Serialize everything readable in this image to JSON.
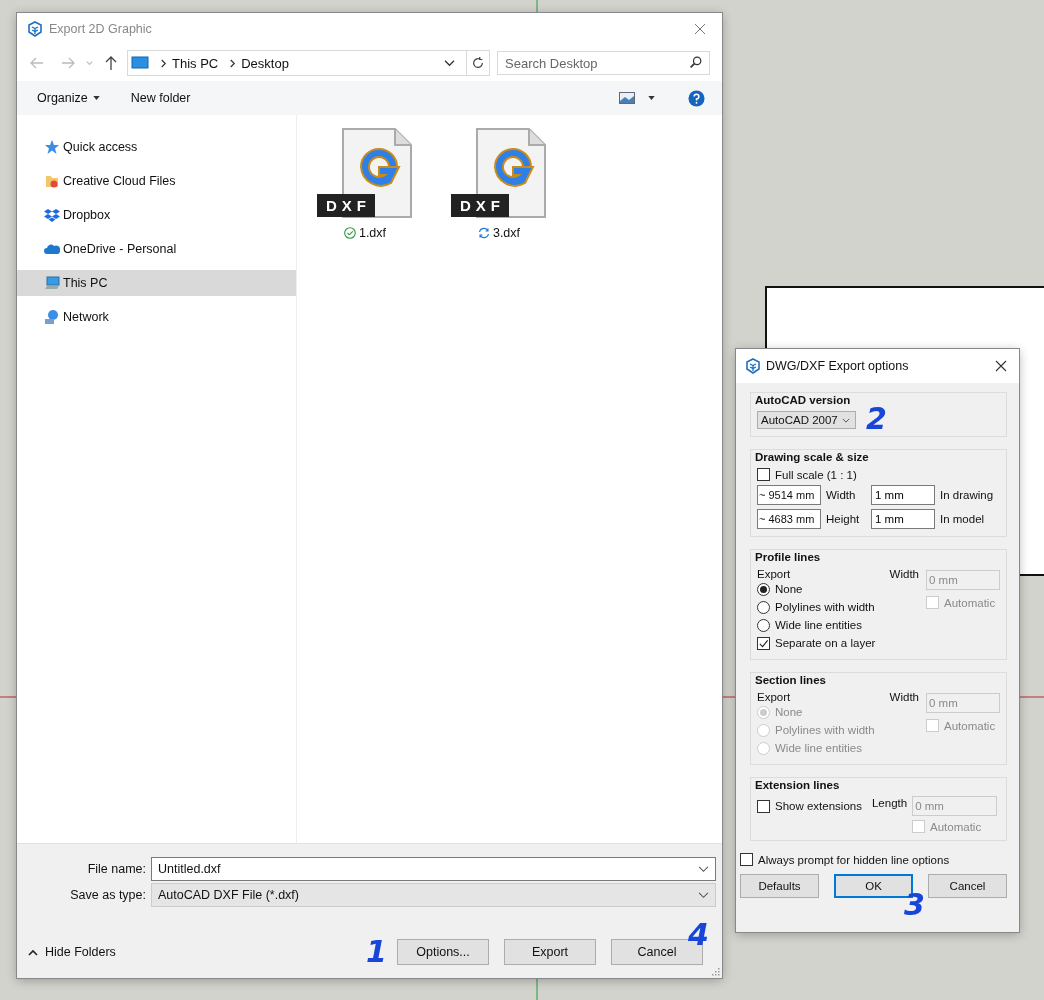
{
  "main_dialog": {
    "title": "Export 2D Graphic",
    "address": {
      "crumbs": [
        "This PC",
        "Desktop"
      ]
    },
    "search": {
      "placeholder": "Search Desktop"
    },
    "toolbar": {
      "organize": "Organize",
      "new_folder": "New folder"
    },
    "sidebar": {
      "items": [
        {
          "label": "Quick access",
          "selected": false
        },
        {
          "label": "Creative Cloud Files",
          "selected": false
        },
        {
          "label": "Dropbox",
          "selected": false
        },
        {
          "label": "OneDrive - Personal",
          "selected": false
        },
        {
          "label": "This PC",
          "selected": true
        },
        {
          "label": "Network",
          "selected": false
        }
      ]
    },
    "files": [
      {
        "name": "1.dxf",
        "badge": "DXF",
        "kind": "synced"
      },
      {
        "name": "3.dxf",
        "badge": "DXF",
        "kind": "syncing"
      }
    ],
    "file_name": {
      "label": "File name:",
      "value": "Untitled.dxf"
    },
    "save_as_type": {
      "label": "Save as type:",
      "value": "AutoCAD DXF File (*.dxf)"
    },
    "hide_folders": "Hide Folders",
    "buttons": [
      "Options...",
      "Export",
      "Cancel"
    ]
  },
  "options_dialog": {
    "title": "DWG/DXF Export options",
    "autocad_version": {
      "heading": "AutoCAD version",
      "value": "AutoCAD 2007"
    },
    "scale": {
      "heading": "Drawing scale & size",
      "full_scale": {
        "label": "Full scale (1 : 1)",
        "checked": false
      },
      "rows": [
        {
          "measure": "~ 9514 mm",
          "label": "Width",
          "value": "1 mm",
          "note": "In drawing"
        },
        {
          "measure": "~ 4683 mm",
          "label": "Height",
          "value": "1 mm",
          "note": "In model"
        }
      ]
    },
    "profile_lines": {
      "heading": "Profile lines",
      "export_label": "Export",
      "disabled": false,
      "options": [
        {
          "label": "None",
          "selected": true
        },
        {
          "label": "Polylines with width",
          "selected": false
        },
        {
          "label": "Wide line entities",
          "selected": false
        }
      ],
      "width_label": "Width",
      "width_value": "0 mm",
      "automatic": {
        "label": "Automatic",
        "checked": false
      },
      "separate": {
        "label": "Separate on a layer",
        "checked": true
      }
    },
    "section_lines": {
      "heading": "Section lines",
      "export_label": "Export",
      "disabled": true,
      "options": [
        {
          "label": "None",
          "selected": true
        },
        {
          "label": "Polylines with width",
          "selected": false
        },
        {
          "label": "Wide line entities",
          "selected": false
        }
      ],
      "width_label": "Width",
      "width_value": "0 mm",
      "automatic": {
        "label": "Automatic",
        "checked": false
      }
    },
    "extension_lines": {
      "heading": "Extension lines",
      "show": {
        "label": "Show extensions",
        "checked": false
      },
      "length_label": "Length",
      "length_value": "0 mm",
      "automatic": {
        "label": "Automatic",
        "checked": false
      }
    },
    "always_prompt": {
      "label": "Always prompt for hidden line options",
      "checked": false
    },
    "buttons": [
      "Defaults",
      "OK",
      "Cancel"
    ]
  },
  "annotations": [
    "1",
    "2",
    "3",
    "4"
  ]
}
